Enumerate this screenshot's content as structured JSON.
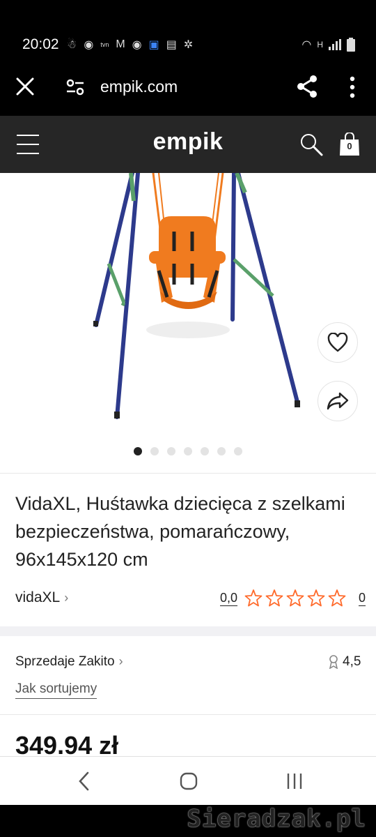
{
  "status_bar": {
    "time": "20:02",
    "left_icons": [
      "messenger-icon",
      "chrome-icon",
      "tvn24-icon",
      "gmail-icon",
      "chrome-icon",
      "app-icon",
      "translate-icon",
      "settings-icon"
    ],
    "right_icons": [
      "wifi-icon",
      "network-h-icon",
      "signal-icon",
      "battery-icon"
    ]
  },
  "browser": {
    "url": "empik.com"
  },
  "header": {
    "logo": "empik",
    "cart_count": "0"
  },
  "product": {
    "title": "VidaXL, Huśtawka dziecięca z szelkami bezpieczeństwa, pomarańczowy, 96x145x120 cm",
    "brand": "vidaXL",
    "rating_value": "0,0",
    "rating_stars": 0,
    "rating_count": "0",
    "carousel_count": 7,
    "carousel_active": 0,
    "price": "349.94 zł"
  },
  "seller": {
    "label": "Sprzedaje Zakito",
    "rating": "4,5",
    "sort_link": "Jak sortujemy"
  },
  "watermark": "Sieradzak.pl",
  "colors": {
    "header_bg": "#262626",
    "swing_orange": "#f07b1f",
    "frame_blue": "#2d3a8c",
    "frame_green": "#5aa06a"
  }
}
